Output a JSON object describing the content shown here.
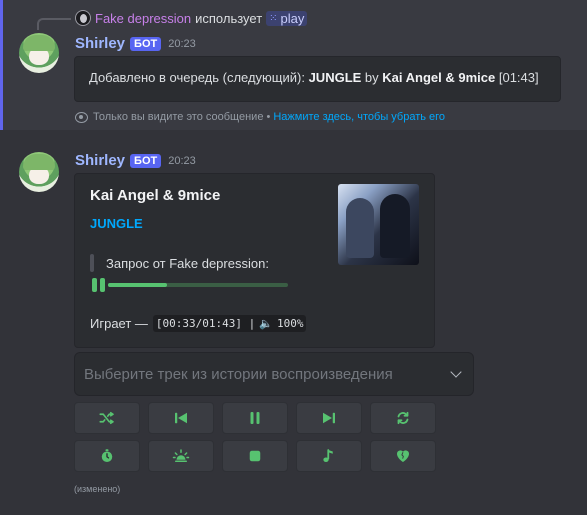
{
  "msg1": {
    "reply": {
      "user": "Fake depression",
      "uses": "использует",
      "command": "play"
    },
    "author": {
      "name": "Shirley",
      "badge": "БОТ",
      "time": "20:23"
    },
    "embed": {
      "prefix": "Добавлено в очередь (следующий): ",
      "title": "JUNGLE",
      "by": " by ",
      "artist": "Kai Angel & 9mice",
      "duration": " [01:43]"
    },
    "ephemeral": {
      "text": "Только вы видите это сообщение •",
      "dismiss": "Нажмите здесь, чтобы убрать его"
    }
  },
  "msg2": {
    "author": {
      "name": "Shirley",
      "badge": "БОТ",
      "time": "20:23"
    },
    "embed": {
      "artist": "Kai Angel & 9mice",
      "title": "JUNGLE",
      "requested": "Запрос от Fake depression:",
      "progress": 0.33,
      "status_label": "Играет —",
      "time_code": "[00:33/01:43] |",
      "volume": "100%"
    },
    "select_placeholder": "Выберите трек из истории воспроизведения",
    "buttons_row1": [
      {
        "name": "shuffle-button",
        "icon": "shuffle-icon"
      },
      {
        "name": "previous-button",
        "icon": "previous-icon"
      },
      {
        "name": "pause-button",
        "icon": "pause-icon"
      },
      {
        "name": "next-button",
        "icon": "next-icon"
      },
      {
        "name": "repeat-button",
        "icon": "repeat-icon"
      }
    ],
    "buttons_row2": [
      {
        "name": "timer-button",
        "icon": "stopwatch-icon"
      },
      {
        "name": "effects-button",
        "icon": "sun-icon"
      },
      {
        "name": "stop-button",
        "icon": "stop-icon"
      },
      {
        "name": "lyrics-button",
        "icon": "music-note-icon"
      },
      {
        "name": "like-button",
        "icon": "heart-icon"
      }
    ],
    "edited": "(изменено)"
  },
  "colors": {
    "accent": "#57c270",
    "link": "#00a8fc",
    "bot_badge": "#5865f2",
    "author": "#9fb7ff",
    "reply_user": "#c780e9"
  }
}
